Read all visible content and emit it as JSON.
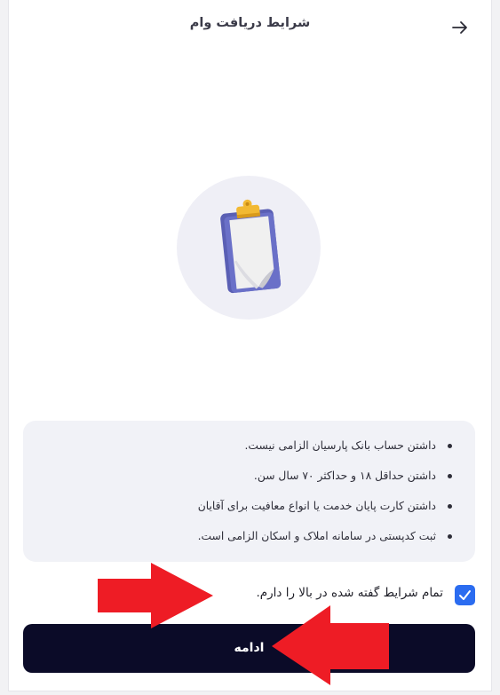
{
  "header": {
    "title": "شرایط دریافت وام",
    "back_icon": "arrow-right-icon"
  },
  "hero": {
    "icon": "clipboard-icon"
  },
  "conditions": {
    "items": [
      "داشتن حساب بانک پارسیان الزامی نیست.",
      "داشتن حداقل ۱۸ و حداکثر ۷۰ سال سن.",
      "داشتن کارت پایان خدمت یا انواع معافیت برای آقایان",
      "ثبت کدپستی در سامانه املاک و اسکان الزامی است."
    ]
  },
  "agreement": {
    "label": "تمام شرایط گفته شده در بالا را دارم.",
    "checked": true,
    "checkbox_color": "#2b6cf0"
  },
  "continue_button": {
    "label": "ادامه",
    "color": "#0b0b28"
  },
  "annotations": {
    "arrow_color": "#ee1c25"
  }
}
